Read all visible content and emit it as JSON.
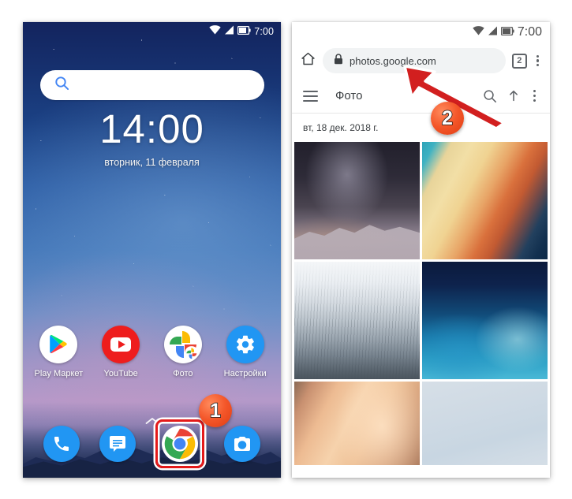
{
  "left_phone": {
    "status_bar": {
      "time": "7:00",
      "icons": [
        "wifi-icon",
        "signal-icon",
        "battery-icon"
      ]
    },
    "search": {
      "icon": "search-icon",
      "placeholder": "",
      "value": ""
    },
    "clock": {
      "time": "14:00",
      "date": "вторник, 11 февраля"
    },
    "apps": [
      {
        "label": "Play Маркет",
        "icon": "play-store-icon"
      },
      {
        "label": "YouTube",
        "icon": "youtube-icon"
      },
      {
        "label": "Фото",
        "icon": "google-photos-icon"
      },
      {
        "label": "Настройки",
        "icon": "settings-gear-icon"
      }
    ],
    "app_drawer_handle": "chevron-up-icon",
    "dock": [
      {
        "label": "Phone",
        "icon": "phone-icon"
      },
      {
        "label": "Messages",
        "icon": "messages-icon"
      },
      {
        "label": "Chrome",
        "icon": "chrome-icon",
        "highlighted": true
      },
      {
        "label": "Camera",
        "icon": "camera-icon"
      }
    ]
  },
  "right_phone": {
    "status_bar": {
      "time": "7:00",
      "icons": [
        "wifi-icon",
        "signal-icon",
        "battery-icon"
      ]
    },
    "browser": {
      "home_icon": "home-icon",
      "lock_icon": "lock-icon",
      "url": "photos.google.com",
      "tab_count": "2",
      "menu_icon": "kebab-menu-icon"
    },
    "photos_app": {
      "menu_icon": "hamburger-menu-icon",
      "title": "Фото",
      "search_icon": "search-icon",
      "upload_icon": "upload-icon",
      "overflow_icon": "kebab-menu-icon",
      "date_header": "вт, 18 дек. 2018 г.",
      "grid": [
        {
          "name": "milky-way-mountain-photo"
        },
        {
          "name": "abstract-orange-teal-photo"
        },
        {
          "name": "snowy-forest-photo"
        },
        {
          "name": "blue-nebula-photo"
        },
        {
          "name": "sand-dunes-photo"
        },
        {
          "name": "pale-blue-sky-photo"
        }
      ]
    }
  },
  "annotations": {
    "step_badges": [
      {
        "number": "1",
        "target": "chrome-dock-icon"
      },
      {
        "number": "2",
        "target": "url-bar"
      }
    ],
    "arrow": {
      "name": "pointer-arrow",
      "target": "url-bar"
    },
    "colors": {
      "badge": "#f4572a",
      "highlight_box": "#e41a1a",
      "accent_blue": "#2196f3"
    }
  }
}
